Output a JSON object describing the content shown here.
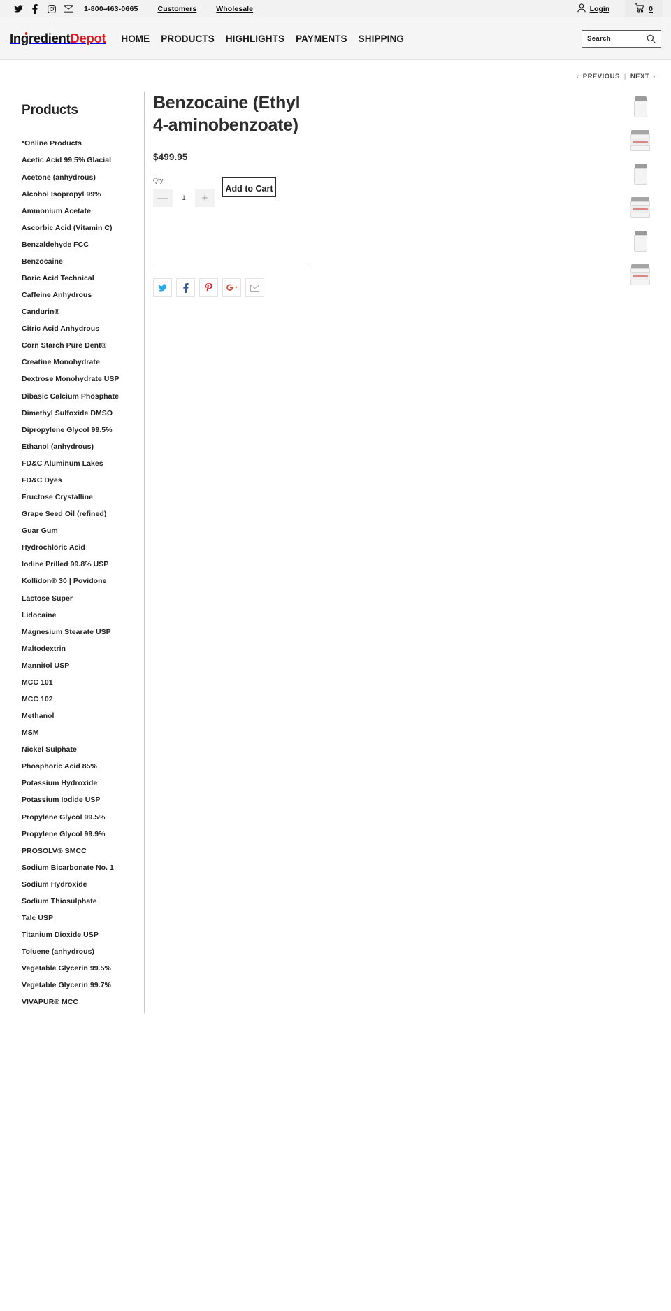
{
  "topbar": {
    "social": [
      {
        "name": "twitter-icon",
        "label": "Twitter"
      },
      {
        "name": "facebook-icon",
        "label": "Facebook"
      },
      {
        "name": "instagram-icon",
        "label": "Instagram"
      },
      {
        "name": "email-icon",
        "label": "Email"
      }
    ],
    "phone": "1-800-463-0665",
    "links": [
      "Customers",
      "Wholesale"
    ],
    "login_label": "Login",
    "cart_count": "0"
  },
  "header": {
    "logo_part_a": "Ingredient",
    "logo_part_b": "Depot",
    "nav": [
      "HOME",
      "PRODUCTS",
      "HIGHLIGHTS",
      "PAYMENTS",
      "SHIPPING"
    ],
    "search_placeholder": "Search",
    "search_value": ""
  },
  "pager": {
    "previous": "PREVIOUS",
    "separator": "|",
    "next": "NEXT",
    "prev_chevron": "‹",
    "next_chevron": "›"
  },
  "sidebar": {
    "heading": "Products",
    "items": [
      "*Online Products",
      "Acetic Acid 99.5% Glacial",
      "Acetone (anhydrous)",
      "Alcohol Isopropyl 99%",
      "Ammonium Acetate",
      "Ascorbic Acid (Vitamin C)",
      "Benzaldehyde FCC",
      "Benzocaine",
      "Boric Acid Technical",
      "Caffeine Anhydrous",
      "Candurin®",
      "Citric Acid Anhydrous",
      "Corn Starch Pure Dent®",
      "Creatine Monohydrate",
      "Dextrose Monohydrate USP",
      "Dibasic Calcium Phosphate",
      "Dimethyl Sulfoxide DMSO",
      "Dipropylene Glycol 99.5%",
      "Ethanol (anhydrous)",
      "FD&C Aluminum Lakes",
      "FD&C Dyes",
      "Fructose Crystalline",
      "Grape Seed Oil (refined)",
      "Guar Gum",
      "Hydrochloric Acid",
      "Iodine Prilled 99.8% USP",
      "Kollidon® 30 | Povidone",
      "Lactose Super",
      "Lidocaine",
      "Magnesium Stearate USP",
      "Maltodextrin",
      "Mannitol USP",
      "MCC 101",
      "MCC 102",
      "Methanol",
      "MSM",
      "Nickel Sulphate",
      "Phosphoric Acid 85%",
      "Potassium Hydroxide",
      "Potassium Iodide USP",
      "Propylene Glycol 99.5%",
      "Propylene Glycol 99.9%",
      "PROSOLV® SMCC",
      "Sodium Bicarbonate No. 1",
      "Sodium Hydroxide",
      "Sodium Thiosulphate",
      "Talc USP",
      "Titanium Dioxide USP",
      "Toluene (anhydrous)",
      "Vegetable Glycerin 99.5%",
      "Vegetable Glycerin 99.7%",
      "VIVAPUR® MCC"
    ]
  },
  "product": {
    "title": "Benzocaine (Ethyl 4-aminobenzoate)",
    "price": "$499.95",
    "qty_label": "Qty",
    "qty_value": "1",
    "decrement_label": "—",
    "increment_label": "+",
    "add_to_cart_label": "Add to Cart"
  },
  "share": [
    {
      "name": "share-twitter-icon",
      "label": "Twitter",
      "color": "#2ba9e1"
    },
    {
      "name": "share-facebook-icon",
      "label": "Facebook",
      "color": "#3b5a98"
    },
    {
      "name": "share-pinterest-icon",
      "label": "Pinterest",
      "color": "#cb2027"
    },
    {
      "name": "share-googleplus-icon",
      "label": "Google Plus",
      "color": "#d34836"
    },
    {
      "name": "share-email-icon",
      "label": "Email",
      "color": "#9a9a9a"
    }
  ],
  "thumbnails": [
    {
      "name": "thumbnail-1",
      "style": "plain"
    },
    {
      "name": "thumbnail-2",
      "style": "labeled"
    },
    {
      "name": "thumbnail-3",
      "style": "plain"
    },
    {
      "name": "thumbnail-4",
      "style": "labeled"
    },
    {
      "name": "thumbnail-5",
      "style": "plain"
    },
    {
      "name": "thumbnail-6",
      "style": "labeled"
    }
  ]
}
